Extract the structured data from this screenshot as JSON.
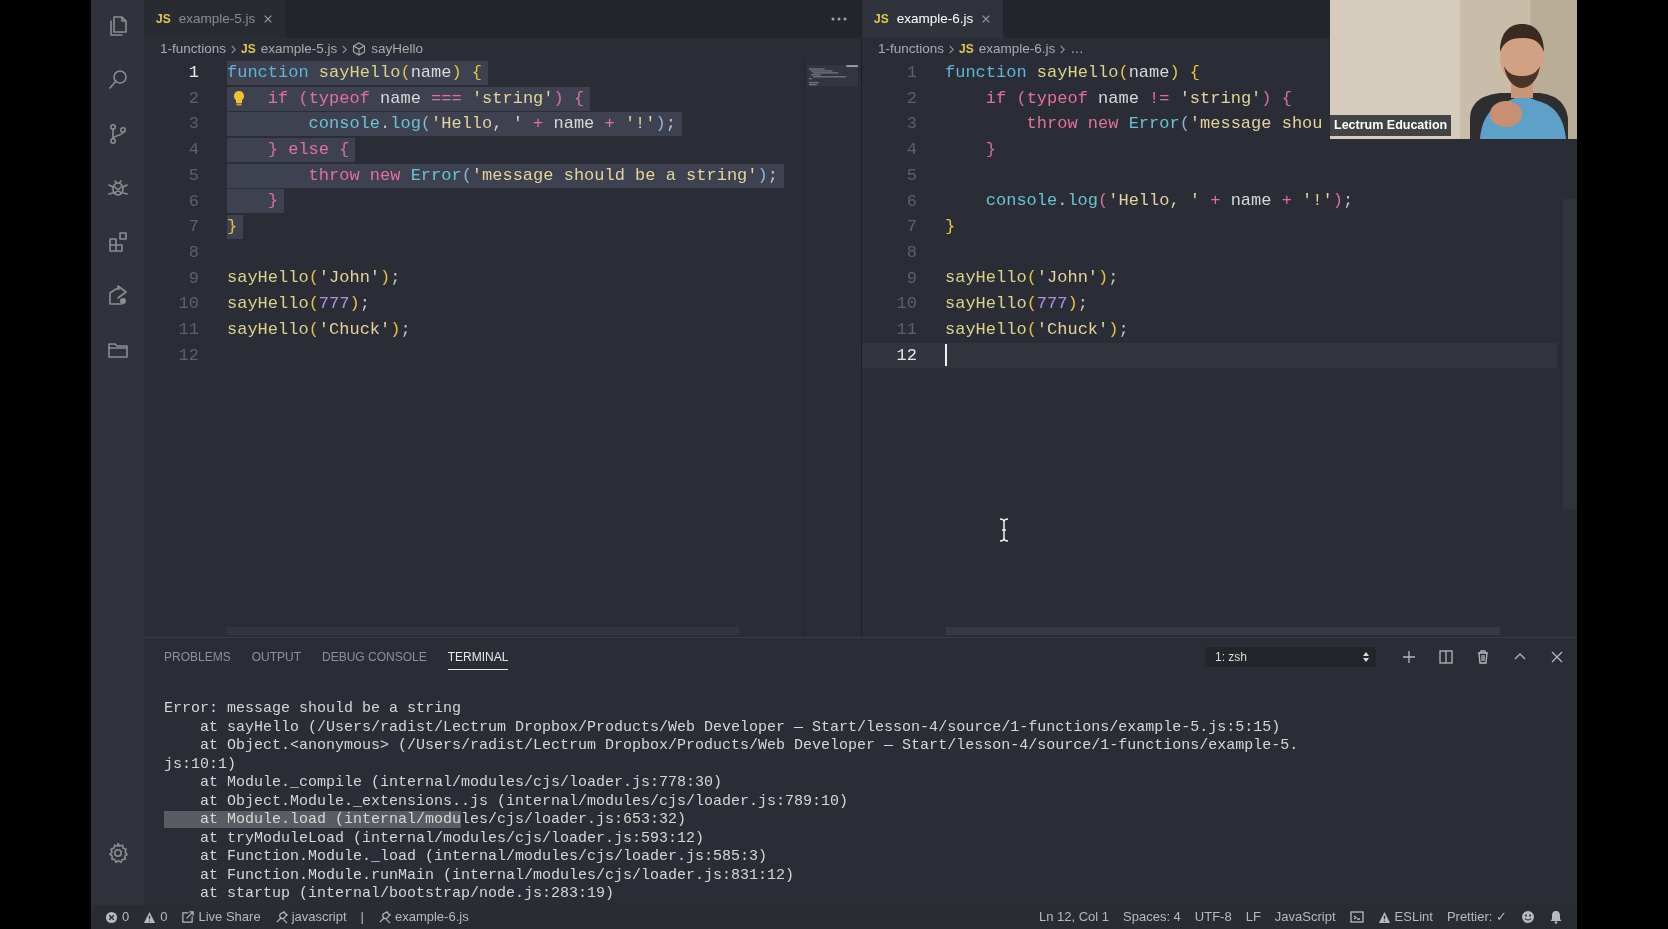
{
  "editor_groups": [
    {
      "focused": false,
      "tab": {
        "icon_text": "JS",
        "label": "example-5.js"
      },
      "breadcrumbs": [
        {
          "kind": "folder",
          "label": "1-functions"
        },
        {
          "kind": "file",
          "icon_text": "JS",
          "label": "example-5.js"
        },
        {
          "kind": "symbol",
          "label": "sayHello"
        }
      ],
      "lines": [
        {
          "number": "1",
          "current": true,
          "highlighted": true,
          "lightbulb": false,
          "tokens": [
            {
              "text": "function ",
              "kind": "keyword"
            },
            {
              "text": "sayHello",
              "kind": "func"
            },
            {
              "text": "(",
              "kind": "b1"
            },
            {
              "text": "name",
              "kind": "plain"
            },
            {
              "text": ") {",
              "kind": "b1"
            }
          ]
        },
        {
          "number": "2",
          "current": false,
          "highlighted": true,
          "lightbulb": true,
          "tokens": [
            {
              "text": "    if ",
              "kind": "control"
            },
            {
              "text": "(",
              "kind": "b2"
            },
            {
              "text": "typeof ",
              "kind": "control"
            },
            {
              "text": "name ",
              "kind": "plain"
            },
            {
              "text": "=== ",
              "kind": "control"
            },
            {
              "text": "'string'",
              "kind": "string"
            },
            {
              "text": ") {",
              "kind": "b2"
            }
          ]
        },
        {
          "number": "3",
          "current": false,
          "highlighted": true,
          "lightbulb": false,
          "tokens": [
            {
              "text": "        console",
              "kind": "builtin"
            },
            {
              "text": ".",
              "kind": "punct"
            },
            {
              "text": "log",
              "kind": "builtin"
            },
            {
              "text": "(",
              "kind": "b3"
            },
            {
              "text": "'Hello, '",
              "kind": "string"
            },
            {
              "text": " + ",
              "kind": "control"
            },
            {
              "text": "name",
              "kind": "plain"
            },
            {
              "text": " + ",
              "kind": "control"
            },
            {
              "text": "'!'",
              "kind": "string"
            },
            {
              "text": ")",
              "kind": "b3"
            },
            {
              "text": ";",
              "kind": "punct"
            }
          ]
        },
        {
          "number": "4",
          "current": false,
          "highlighted": true,
          "lightbulb": false,
          "tokens": [
            {
              "text": "    } ",
              "kind": "b2"
            },
            {
              "text": "else ",
              "kind": "control"
            },
            {
              "text": "{",
              "kind": "b2"
            }
          ]
        },
        {
          "number": "5",
          "current": false,
          "highlighted": true,
          "lightbulb": false,
          "tokens": [
            {
              "text": "        throw new ",
              "kind": "control"
            },
            {
              "text": "Error",
              "kind": "builtin"
            },
            {
              "text": "(",
              "kind": "b3"
            },
            {
              "text": "'message should be a string'",
              "kind": "string"
            },
            {
              "text": ")",
              "kind": "b3"
            },
            {
              "text": ";",
              "kind": "punct"
            }
          ]
        },
        {
          "number": "6",
          "current": false,
          "highlighted": true,
          "lightbulb": false,
          "tokens": [
            {
              "text": "    }",
              "kind": "b2"
            }
          ]
        },
        {
          "number": "7",
          "current": false,
          "highlighted": true,
          "lightbulb": false,
          "tokens": [
            {
              "text": "}",
              "kind": "b1"
            }
          ]
        },
        {
          "number": "8",
          "current": false,
          "lightbulb": false
        },
        {
          "number": "9",
          "current": false,
          "highlighted": false,
          "lightbulb": false,
          "tokens": [
            {
              "text": "sayHello",
              "kind": "func"
            },
            {
              "text": "(",
              "kind": "b1"
            },
            {
              "text": "'John'",
              "kind": "string"
            },
            {
              "text": ")",
              "kind": "b1"
            },
            {
              "text": ";",
              "kind": "punct"
            }
          ]
        },
        {
          "number": "10",
          "current": false,
          "highlighted": false,
          "lightbulb": false,
          "tokens": [
            {
              "text": "sayHello",
              "kind": "func"
            },
            {
              "text": "(",
              "kind": "b1"
            },
            {
              "text": "777",
              "kind": "number"
            },
            {
              "text": ")",
              "kind": "b1"
            },
            {
              "text": ";",
              "kind": "punct"
            }
          ]
        },
        {
          "number": "11",
          "current": false,
          "highlighted": false,
          "lightbulb": false,
          "tokens": [
            {
              "text": "sayHello",
              "kind": "func"
            },
            {
              "text": "(",
              "kind": "b1"
            },
            {
              "text": "'Chuck'",
              "kind": "string"
            },
            {
              "text": ")",
              "kind": "b1"
            },
            {
              "text": ";",
              "kind": "punct"
            }
          ]
        },
        {
          "number": "12",
          "current": false,
          "lightbulb": false
        }
      ]
    },
    {
      "focused": true,
      "tab": {
        "icon_text": "JS",
        "label": "example-6.js"
      },
      "breadcrumbs": [
        {
          "kind": "folder",
          "label": "1-functions"
        },
        {
          "kind": "file",
          "icon_text": "JS",
          "label": "example-6.js"
        },
        {
          "kind": "more",
          "label": "…"
        }
      ],
      "lines": [
        {
          "number": "1",
          "current": false,
          "highlighted": false,
          "lightbulb": false,
          "tokens": [
            {
              "text": "function ",
              "kind": "keyword"
            },
            {
              "text": "sayHello",
              "kind": "func"
            },
            {
              "text": "(",
              "kind": "b1"
            },
            {
              "text": "name",
              "kind": "plain"
            },
            {
              "text": ") {",
              "kind": "b1"
            }
          ]
        },
        {
          "number": "2",
          "current": false,
          "highlighted": false,
          "lightbulb": false,
          "tokens": [
            {
              "text": "    if ",
              "kind": "control"
            },
            {
              "text": "(",
              "kind": "b2"
            },
            {
              "text": "typeof ",
              "kind": "control"
            },
            {
              "text": "name ",
              "kind": "plain"
            },
            {
              "text": "!= ",
              "kind": "control"
            },
            {
              "text": "'string'",
              "kind": "string"
            },
            {
              "text": ") {",
              "kind": "b2"
            }
          ]
        },
        {
          "number": "3",
          "current": false,
          "highlighted": false,
          "lightbulb": false,
          "tokens": [
            {
              "text": "        throw new ",
              "kind": "control"
            },
            {
              "text": "Error",
              "kind": "builtin"
            },
            {
              "text": "(",
              "kind": "b3"
            },
            {
              "text": "'message shou",
              "kind": "string"
            }
          ]
        },
        {
          "number": "4",
          "current": false,
          "highlighted": false,
          "lightbulb": false,
          "tokens": [
            {
              "text": "    }",
              "kind": "b2"
            }
          ]
        },
        {
          "number": "5",
          "current": false,
          "lightbulb": false
        },
        {
          "number": "6",
          "current": false,
          "highlighted": false,
          "lightbulb": false,
          "tokens": [
            {
              "text": "    console",
              "kind": "builtin"
            },
            {
              "text": ".",
              "kind": "punct"
            },
            {
              "text": "log",
              "kind": "builtin"
            },
            {
              "text": "(",
              "kind": "b2"
            },
            {
              "text": "'Hello, '",
              "kind": "string"
            },
            {
              "text": " + ",
              "kind": "control"
            },
            {
              "text": "name",
              "kind": "plain"
            },
            {
              "text": " + ",
              "kind": "control"
            },
            {
              "text": "'!'",
              "kind": "string"
            },
            {
              "text": ")",
              "kind": "b2"
            },
            {
              "text": ";",
              "kind": "punct"
            }
          ]
        },
        {
          "number": "7",
          "current": false,
          "highlighted": false,
          "lightbulb": false,
          "tokens": [
            {
              "text": "}",
              "kind": "b1"
            }
          ]
        },
        {
          "number": "8",
          "current": false,
          "lightbulb": false
        },
        {
          "number": "9",
          "current": false,
          "highlighted": false,
          "lightbulb": false,
          "tokens": [
            {
              "text": "sayHello",
              "kind": "func"
            },
            {
              "text": "(",
              "kind": "b1"
            },
            {
              "text": "'John'",
              "kind": "string"
            },
            {
              "text": ")",
              "kind": "b1"
            },
            {
              "text": ";",
              "kind": "punct"
            }
          ]
        },
        {
          "number": "10",
          "current": false,
          "highlighted": false,
          "lightbulb": false,
          "tokens": [
            {
              "text": "sayHello",
              "kind": "func"
            },
            {
              "text": "(",
              "kind": "b1"
            },
            {
              "text": "777",
              "kind": "number"
            },
            {
              "text": ")",
              "kind": "b1"
            },
            {
              "text": ";",
              "kind": "punct"
            }
          ]
        },
        {
          "number": "11",
          "current": false,
          "highlighted": false,
          "lightbulb": false,
          "tokens": [
            {
              "text": "sayHello",
              "kind": "func"
            },
            {
              "text": "(",
              "kind": "b1"
            },
            {
              "text": "'Chuck'",
              "kind": "string"
            },
            {
              "text": ")",
              "kind": "b1"
            },
            {
              "text": ";",
              "kind": "punct"
            }
          ]
        },
        {
          "number": "12",
          "current": true,
          "lightbulb": false
        }
      ],
      "webcam": {
        "kind": "picture",
        "caption": "Lectrum Education"
      }
    }
  ],
  "panel": {
    "tabs": [
      {
        "label": "PROBLEMS",
        "selected": false
      },
      {
        "label": "OUTPUT",
        "selected": false
      },
      {
        "label": "DEBUG CONSOLE",
        "selected": false
      },
      {
        "label": "TERMINAL",
        "selected": true
      }
    ],
    "terminal_select": {
      "value": "1: zsh"
    },
    "lines": [
      {
        "text": "Error: message should be a string"
      },
      {
        "text": "    at sayHello (/Users/radist/Lectrum Dropbox/Products/Web Developer — Start/lesson-4/source/1-functions/example-5.js:5:15)"
      },
      {
        "text": "    at Object.<anonymous> (/Users/radist/Lectrum Dropbox/Products/Web Developer — Start/lesson-4/source/1-functions/example-5."
      },
      {
        "text": "js:10:1)"
      },
      {
        "text": "    at Module._compile (internal/modules/cjs/loader.js:778:30)"
      },
      {
        "text": "    at Object.Module._extensions..js (internal/modules/cjs/loader.js:789:10)"
      },
      {
        "selected_text": "    at Module.load (internal/modu",
        "text": "les/cjs/loader.js:653:32)"
      },
      {
        "text": "    at tryModuleLoad (internal/modules/cjs/loader.js:593:12)"
      },
      {
        "text": "    at Function.Module._load (internal/modules/cjs/loader.js:585:3)"
      },
      {
        "text": "    at Function.Module.runMain (internal/modules/cjs/loader.js:831:12)"
      },
      {
        "text": "    at startup (internal/bootstrap/node.js:283:19)"
      }
    ]
  },
  "status_bar": {
    "left": [
      {
        "kind": "errors",
        "text": "0"
      },
      {
        "kind": "warnings",
        "text": "0"
      },
      {
        "kind": "live-share",
        "text": "Live Share"
      },
      {
        "kind": "tool",
        "text": "javascript"
      },
      {
        "kind": "separator",
        "text": "|"
      },
      {
        "kind": "tool",
        "text": "example-6.js"
      }
    ],
    "right": [
      {
        "kind": "text",
        "text": "Ln 12, Col 1"
      },
      {
        "kind": "text",
        "text": "Spaces: 4"
      },
      {
        "kind": "text",
        "text": "UTF-8"
      },
      {
        "kind": "text",
        "text": "LF"
      },
      {
        "kind": "text",
        "text": "JavaScript"
      },
      {
        "kind": "feedback"
      },
      {
        "kind": "eslint",
        "text": "ESLint"
      },
      {
        "kind": "text",
        "text": "Prettier: ✓"
      },
      {
        "kind": "smiley"
      },
      {
        "kind": "bell"
      }
    ]
  }
}
